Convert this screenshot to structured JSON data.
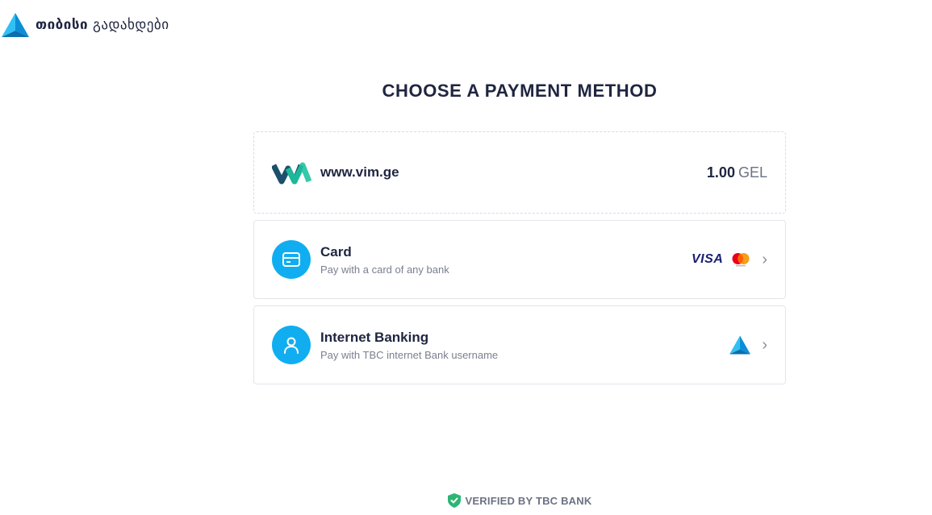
{
  "header": {
    "brand_bold": "თიბისი",
    "brand_light": "გადახდები"
  },
  "page": {
    "title": "CHOOSE A PAYMENT METHOD"
  },
  "merchant": {
    "name": "www.vim.ge",
    "amount": "1.00",
    "currency": "GEL"
  },
  "methods": [
    {
      "title": "Card",
      "subtitle": "Pay with a card of any bank",
      "icon": "credit-card-icon",
      "brands": [
        "VISA",
        "mastercard"
      ]
    },
    {
      "title": "Internet Banking",
      "subtitle": "Pay with TBC internet Bank username",
      "icon": "user-icon",
      "brands": [
        "tbc-logo"
      ]
    }
  ],
  "footer": {
    "verified": "VERIFIED BY TBC BANK"
  },
  "colors": {
    "accent": "#10aef0",
    "text": "#1f2540",
    "muted": "#7a8090",
    "verified_green": "#2bb673"
  }
}
